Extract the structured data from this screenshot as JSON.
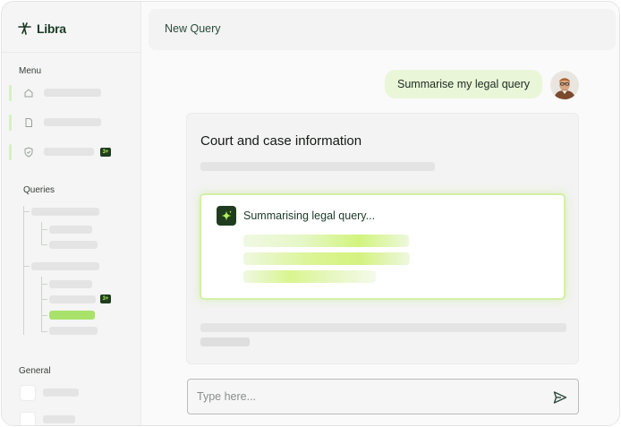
{
  "app": {
    "name": "Libra"
  },
  "sidebar": {
    "menu_label": "Menu",
    "menu_items": [
      {
        "icon": "home-icon"
      },
      {
        "icon": "document-icon"
      },
      {
        "icon": "shield-icon",
        "badge": "3+"
      }
    ],
    "queries_label": "Queries",
    "query_badge": "3+",
    "general_label": "General"
  },
  "header": {
    "title": "New Query"
  },
  "chat": {
    "user_message": "Summarise my legal query",
    "card_title": "Court and case information",
    "status_text": "Summarising legal query..."
  },
  "input": {
    "placeholder": "Type here..."
  },
  "colors": {
    "brand_dark": "#1f3d1e",
    "accent_lime": "#b5f05a",
    "bubble_bg": "#eaf6d8",
    "active_query": "#a9e26a"
  }
}
